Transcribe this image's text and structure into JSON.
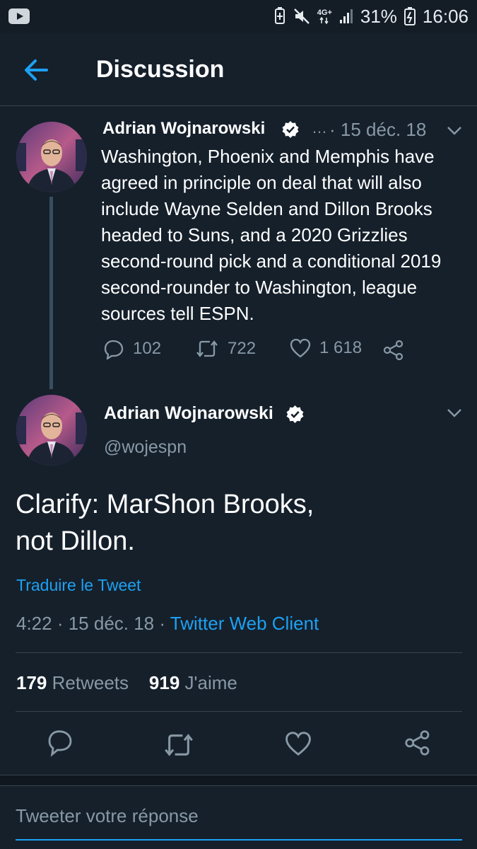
{
  "status_bar": {
    "network": "4G+",
    "battery": "31%",
    "time": "16:06",
    "icons": [
      "youtube-icon",
      "battery-saver-icon",
      "mute-icon",
      "signal-icon",
      "battery-icon"
    ]
  },
  "header": {
    "back_icon": "arrow-left-icon",
    "title": "Discussion"
  },
  "parent_tweet": {
    "name": "Adrian Wojnarowski",
    "ellipsis": "…",
    "date": "· 15 déc. 18",
    "text": "Washington, Phoenix and Memphis have agreed in principle on deal that will also include Wayne Selden and Dillon Brooks headed to Suns, and a 2020 Grizzlies second-round pick and a conditional 2019 second-rounder to Washington, league sources tell ESPN.",
    "replies": "102",
    "retweets": "722",
    "likes": "1 618"
  },
  "main_tweet": {
    "name": "Adrian Wojnarowski",
    "handle": "@wojespn",
    "text_line1": "Clarify: MarShon Brooks,",
    "text_line2": "not Dillon.",
    "translate": "Traduire le Tweet",
    "time_date": "4:22 · 15 déc. 18 · ",
    "client": "Twitter Web Client",
    "retweets_count": "179",
    "retweets_label": "Retweets",
    "likes_count": "919",
    "likes_label": "J'aime"
  },
  "reply": {
    "placeholder": "Tweeter votre réponse"
  },
  "colors": {
    "background": "#15202b",
    "accent": "#1da1f2",
    "muted": "#8899a6",
    "divider": "#38444d"
  }
}
